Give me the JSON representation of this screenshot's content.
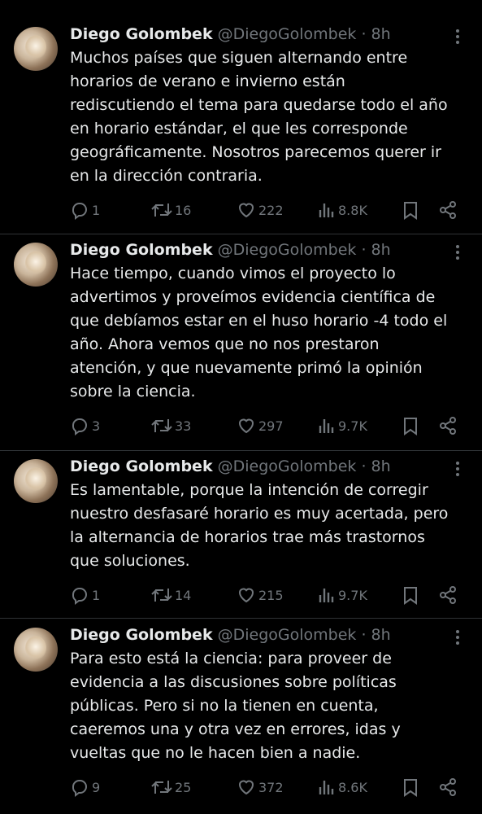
{
  "tweets": [
    {
      "name": "Diego Golombek",
      "handle": "@DiegoGolombek",
      "time": "· 8h",
      "text": "Muchos países que siguen alternando entre\nhorarios de verano e invierno están\nrediscutiendo el tema para quedarse todo el año\nen horario estándar, el que les corresponde\ngeográficamente. Nosotros parecemos querer ir\nen la dirección contraria.",
      "replies": "1",
      "retweets": "16",
      "likes": "222",
      "views": "8.8K"
    },
    {
      "name": "Diego Golombek",
      "handle": "@DiegoGolombek",
      "time": "· 8h",
      "text": "Hace tiempo, cuando vimos el proyecto lo\nadvertimos y proveímos evidencia científica de\nque debíamos estar en el huso horario -4 todo el\naño. Ahora vemos que no nos prestaron\natención, y que nuevamente primó la opinión\nsobre la ciencia.",
      "replies": "3",
      "retweets": "33",
      "likes": "297",
      "views": "9.7K"
    },
    {
      "name": "Diego Golombek",
      "handle": "@DiegoGolombek",
      "time": "· 8h",
      "text": "Es lamentable, porque la intención de corregir\nnuestro desfasaré horario es muy acertada, pero\nla alternancia de horarios trae más trastornos\nque soluciones.",
      "replies": "1",
      "retweets": "14",
      "likes": "215",
      "views": "9.7K"
    },
    {
      "name": "Diego Golombek",
      "handle": "@DiegoGolombek",
      "time": "· 8h",
      "text": "Para esto está la ciencia: para proveer de\nevidencia a las discusiones sobre políticas\npúblicas. Pero si no la tienen en cuenta,\ncaeremos una y otra vez en errores, idas y\nvueltas que no le hacen bien a nadie.",
      "replies": "9",
      "retweets": "25",
      "likes": "372",
      "views": "8.6K"
    }
  ],
  "icons": {
    "reply": "reply-icon",
    "retweet": "retweet-icon",
    "like": "heart-icon",
    "views": "views-icon",
    "bookmark": "bookmark-icon",
    "share": "share-icon",
    "more": "more-icon"
  },
  "colors": {
    "background": "#000000",
    "text": "#e7e9ea",
    "muted": "#71767b",
    "divider": "#2f3336"
  }
}
